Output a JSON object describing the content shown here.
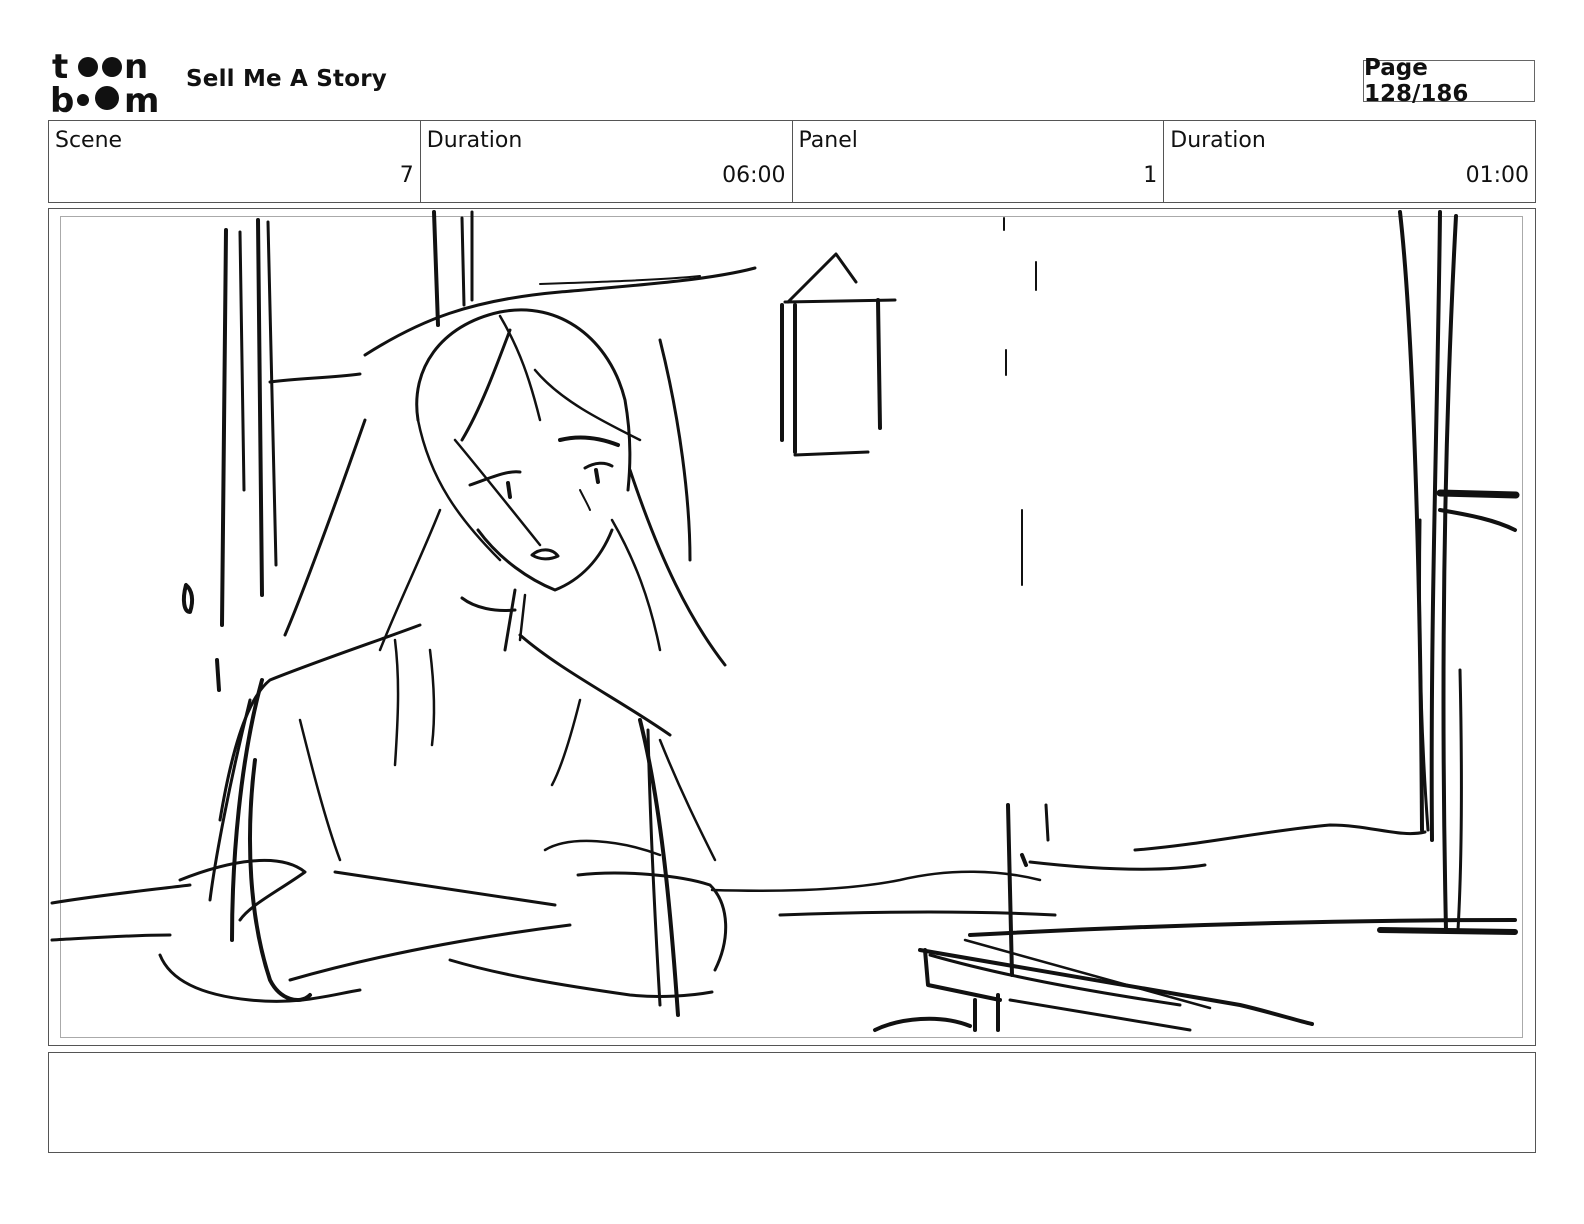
{
  "header": {
    "logo_text": "toon boom",
    "project_title": "Sell Me A Story",
    "page_label": "Page 128/186"
  },
  "info": {
    "scene_label": "Scene",
    "scene_value": "7",
    "scene_duration_label": "Duration",
    "scene_duration_value": "06:00",
    "panel_label": "Panel",
    "panel_value": "1",
    "panel_duration_label": "Duration",
    "panel_duration_value": "01:00"
  },
  "panel": {
    "image_description": "rough storyboard sketch"
  },
  "notes": {
    "text": ""
  }
}
